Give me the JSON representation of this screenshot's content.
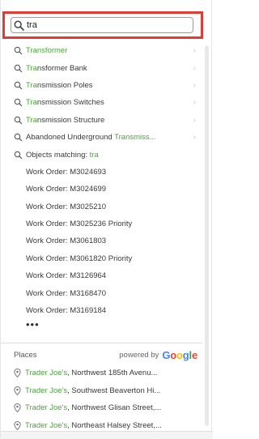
{
  "search": {
    "value": "tra",
    "placeholder": ""
  },
  "suggestions": [
    {
      "prefix": "",
      "match": "Transformer",
      "suffix": ""
    },
    {
      "prefix": "",
      "match": "Tra",
      "suffix": "nsformer Bank"
    },
    {
      "prefix": "",
      "match": "Tra",
      "suffix": "nsmission Poles"
    },
    {
      "prefix": "",
      "match": "Tra",
      "suffix": "nsmission Switches"
    },
    {
      "prefix": "",
      "match": "Tra",
      "suffix": "nsmission Structure"
    },
    {
      "prefix": "Abandoned Underground ",
      "match": "Transmiss...",
      "suffix": ""
    }
  ],
  "objects_matching": {
    "label": "Objects matching: ",
    "term": "tra"
  },
  "work_orders": [
    "Work Order: M3024693",
    "Work Order: M3024699",
    "Work Order: M3025210",
    "Work Order: M3025236 Priority",
    "Work Order: M3061803",
    "Work Order: M3061820 Priority",
    "Work Order: M3126964",
    "Work Order: M3168470",
    "Work Order: M3169184"
  ],
  "more_label": "•••",
  "places": {
    "header": "Places",
    "powered_by": "powered by",
    "google": "Google",
    "items": [
      {
        "match": "Trader Joe's",
        "rest": ", Northwest 185th Avenu..."
      },
      {
        "match": "Trader Joe's",
        "rest": ", Southwest Beaverton Hi..."
      },
      {
        "match": "Trader Joe's",
        "rest": ", Northwest Glisan Street,..."
      },
      {
        "match": "Trader Joe's",
        "rest": ", Northeast Halsey Street,..."
      }
    ]
  },
  "colors": {
    "highlight": "#4ba33c",
    "focus_border": "#e23a34"
  },
  "icons": {
    "search": "search-icon",
    "suggestion": "search-icon",
    "chevron": "chevron-right-icon",
    "place": "map-pin-icon"
  }
}
